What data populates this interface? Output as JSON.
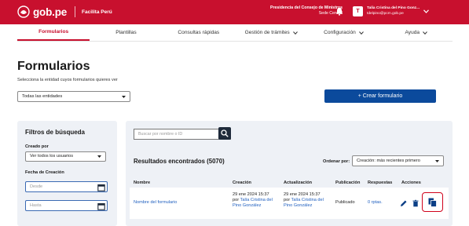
{
  "topbar": {
    "brand_name": "gob.pe",
    "brand_sub": "Facilita Perú",
    "org_line1": "Presidencia del Consejo de Ministros",
    "org_line2": "Sede Central",
    "avatar_initial": "T",
    "user_name": "Talía Cristina del Pino Gonz...",
    "user_email": "tdelpino@pcm.gob.pe",
    "brand_color": "#c8102e"
  },
  "nav": [
    {
      "label": "Formularios",
      "active": true
    },
    {
      "label": "Plantillas"
    },
    {
      "label": "Consultas rápidas"
    },
    {
      "label": "Gestión de trámites"
    },
    {
      "label": "Configuración"
    },
    {
      "label": "Ayuda"
    }
  ],
  "header": {
    "title": "Formularios",
    "subtitle": "Selecciona la entidad cuyos formularios quieres ver",
    "entity_select": "Todas las entidades",
    "create_button": "+  Crear formulario"
  },
  "filters": {
    "title": "Filtros de búsqueda",
    "created_by_label": "Creado por",
    "created_by_value": "Ver todos los usuarios",
    "date_label": "Fecha de Creación",
    "from_placeholder": "Desde",
    "to_placeholder": "Hasta"
  },
  "results": {
    "search_placeholder": "Buscar por nombre o ID",
    "title": "Resultados encontrados (5070)",
    "order_label": "Ordenar por:",
    "order_value": "Creación: más recientes primero",
    "columns": [
      "Nombre",
      "Creación",
      "Actualización",
      "Publicación",
      "Respuestas",
      "Acciones"
    ],
    "rows": [
      {
        "name": "Nombre del formulario",
        "created_date": "29 ene 2024 15:37",
        "created_by_prefix": "por ",
        "created_by": "Talía Cristina del Pino González",
        "updated_date": "29 ene 2024 15:37",
        "updated_by_prefix": "por ",
        "updated_by": "Talía Cristina del Pino González",
        "status": "Publicado",
        "responses": "0 rptas."
      }
    ]
  },
  "icons": {
    "bell": "bell-icon",
    "search": "search-icon",
    "calendar": "calendar-icon",
    "edit": "pencil-icon",
    "delete": "trash-icon",
    "duplicate": "copy-icon"
  },
  "accent_blue": "#0b4a9c",
  "highlight_red": "#d0021b"
}
